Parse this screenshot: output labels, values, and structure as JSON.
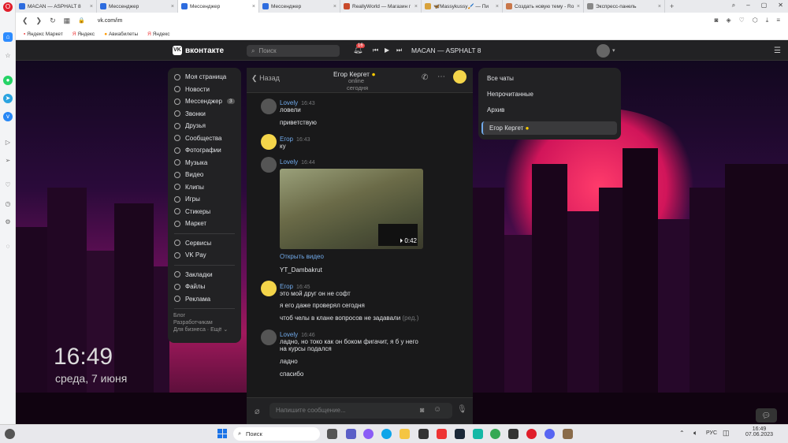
{
  "browser": {
    "tabs": [
      {
        "label": "MACAN — ASPHALT 8",
        "color": "#2d6cdf",
        "active": false
      },
      {
        "label": "Мессенджер",
        "color": "#2d6cdf",
        "active": false
      },
      {
        "label": "Мессенджер",
        "color": "#2d6cdf",
        "active": true
      },
      {
        "label": "Мессенджер",
        "color": "#2d6cdf",
        "active": false
      },
      {
        "label": "ReallyWorld — Магазин г",
        "color": "#c94a2b",
        "active": false
      },
      {
        "label": "🦋Massykussy🖌️ — Пи",
        "color": "#d8a13a",
        "active": false
      },
      {
        "label": "Создать новую тему - Ro",
        "color": "#c9774a",
        "active": false
      },
      {
        "label": "Экспресс-панель",
        "color": "#888888",
        "active": false
      }
    ],
    "url": "vk.com/im",
    "bookmarks": [
      "Яндекс Маркет",
      "Яндекс",
      "Авиабилеты",
      "Яндекс"
    ]
  },
  "vk": {
    "logo": "вконтакте",
    "search_placeholder": "Поиск",
    "notif_count": "16",
    "player_track": "MACAN — ASPHALT 8",
    "menu": [
      {
        "label": "Моя страница",
        "icon": "user-icon"
      },
      {
        "label": "Новости",
        "icon": "news-icon"
      },
      {
        "label": "Мессенджер",
        "icon": "chat-icon",
        "count": "3"
      },
      {
        "label": "Звонки",
        "icon": "phone-icon"
      },
      {
        "label": "Друзья",
        "icon": "friends-icon"
      },
      {
        "label": "Сообщества",
        "icon": "groups-icon"
      },
      {
        "label": "Фотографии",
        "icon": "photo-icon"
      },
      {
        "label": "Музыка",
        "icon": "music-icon"
      },
      {
        "label": "Видео",
        "icon": "video-icon"
      },
      {
        "label": "Клипы",
        "icon": "clips-icon"
      },
      {
        "label": "Игры",
        "icon": "games-icon"
      },
      {
        "label": "Стикеры",
        "icon": "sticker-icon"
      },
      {
        "label": "Маркет",
        "icon": "market-icon"
      }
    ],
    "menu2": [
      {
        "label": "Сервисы",
        "icon": "services-icon"
      },
      {
        "label": "VK Pay",
        "icon": "vkpay-icon"
      }
    ],
    "menu3": [
      {
        "label": "Закладки",
        "icon": "bookmark-icon"
      },
      {
        "label": "Файлы",
        "icon": "files-icon"
      },
      {
        "label": "Реклама",
        "icon": "ads-icon"
      }
    ],
    "footer": {
      "blog": "Блог",
      "dev": "Разработчикам",
      "biz": "Для бизнеса",
      "more": "Ещё"
    },
    "chat": {
      "back": "Назад",
      "contact": "Егор Кергет",
      "status": "online",
      "date": "сегодня",
      "input_placeholder": "Напишите сообщение...",
      "messages": [
        {
          "name": "Lovely",
          "time": "16:43",
          "lines": [
            "ловели",
            "приветствую"
          ]
        },
        {
          "name": "Егор",
          "time": "16:43",
          "lines": [
            "ку"
          ]
        },
        {
          "name": "Lovely",
          "time": "16:44",
          "video_duration": "0:42",
          "link": "Открыть видео",
          "lines": [
            "YT_Dambakrut"
          ]
        },
        {
          "name": "Егор",
          "time": "16:45",
          "lines": [
            "это мой друг он не софт",
            "я его даже проверял сегодня",
            "чтоб челы в клане вопросов не задавали"
          ],
          "edited": "(ред.)"
        },
        {
          "name": "Lovely",
          "time": "16:46",
          "lines": [
            "ладно, но токо как он боком фигачит, я б у него",
            "на курсы подался",
            "ладно",
            "спасибо"
          ]
        }
      ]
    },
    "filters": [
      "Все чаты",
      "Непрочитанные",
      "Архив"
    ],
    "selected_chat": "Егор Кергет"
  },
  "desktop": {
    "time": "16:49",
    "date": "среда, 7 июня"
  },
  "taskbar": {
    "search": "Поиск",
    "lang": "РУС",
    "time": "16:49",
    "date": "07.06.2023"
  }
}
